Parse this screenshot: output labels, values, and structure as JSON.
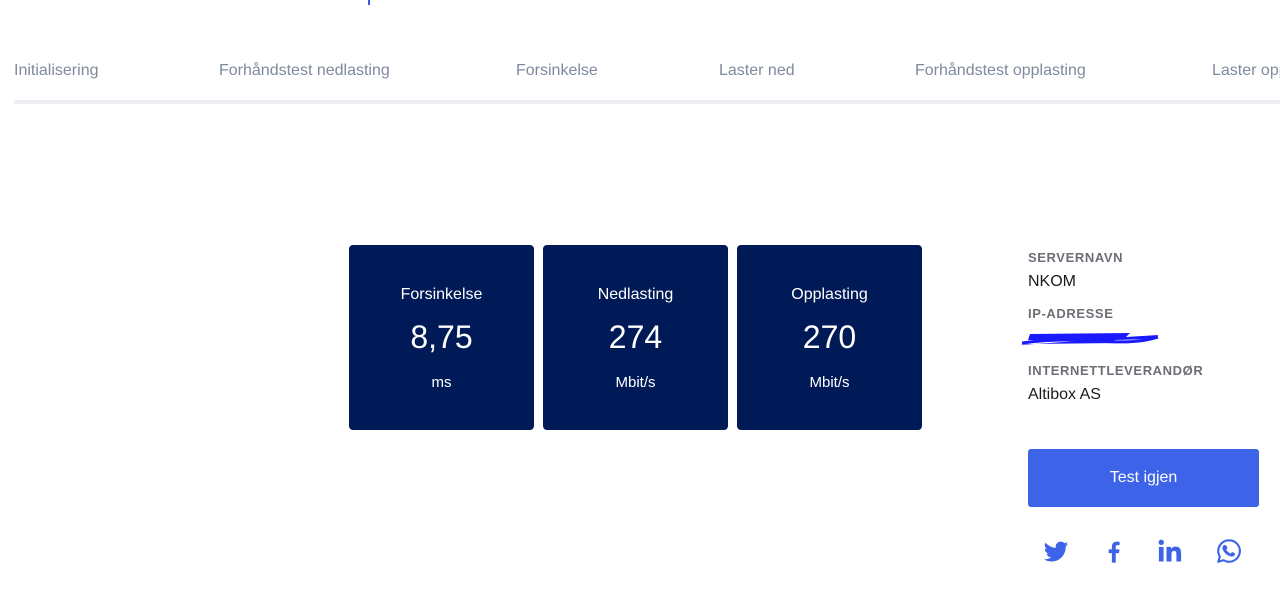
{
  "steps": [
    {
      "label": "Initialisering"
    },
    {
      "label": "Forhåndstest nedlasting"
    },
    {
      "label": "Forsinkelse"
    },
    {
      "label": "Laster ned"
    },
    {
      "label": "Forhåndstest opplasting"
    },
    {
      "label": "Laster opp"
    }
  ],
  "results": [
    {
      "label": "Forsinkelse",
      "value": "8,75",
      "unit": "ms"
    },
    {
      "label": "Nedlasting",
      "value": "274",
      "unit": "Mbit/s"
    },
    {
      "label": "Opplasting",
      "value": "270",
      "unit": "Mbit/s"
    }
  ],
  "info": {
    "server_label": "SERVERNAVN",
    "server_value": "NKOM",
    "ip_label": "IP-ADRESSE",
    "isp_label": "INTERNETTLEVERANDØR",
    "isp_value": "Altibox AS"
  },
  "actions": {
    "test_again": "Test igjen"
  },
  "social": [
    {
      "icon": "twitter-icon"
    },
    {
      "icon": "facebook-icon"
    },
    {
      "icon": "linkedin-icon"
    },
    {
      "icon": "whatsapp-icon"
    }
  ],
  "colors": {
    "card_bg": "#001a57",
    "button_bg": "#3d63e8",
    "social_icon": "#3d63e8",
    "redaction": "#1a1aff"
  }
}
